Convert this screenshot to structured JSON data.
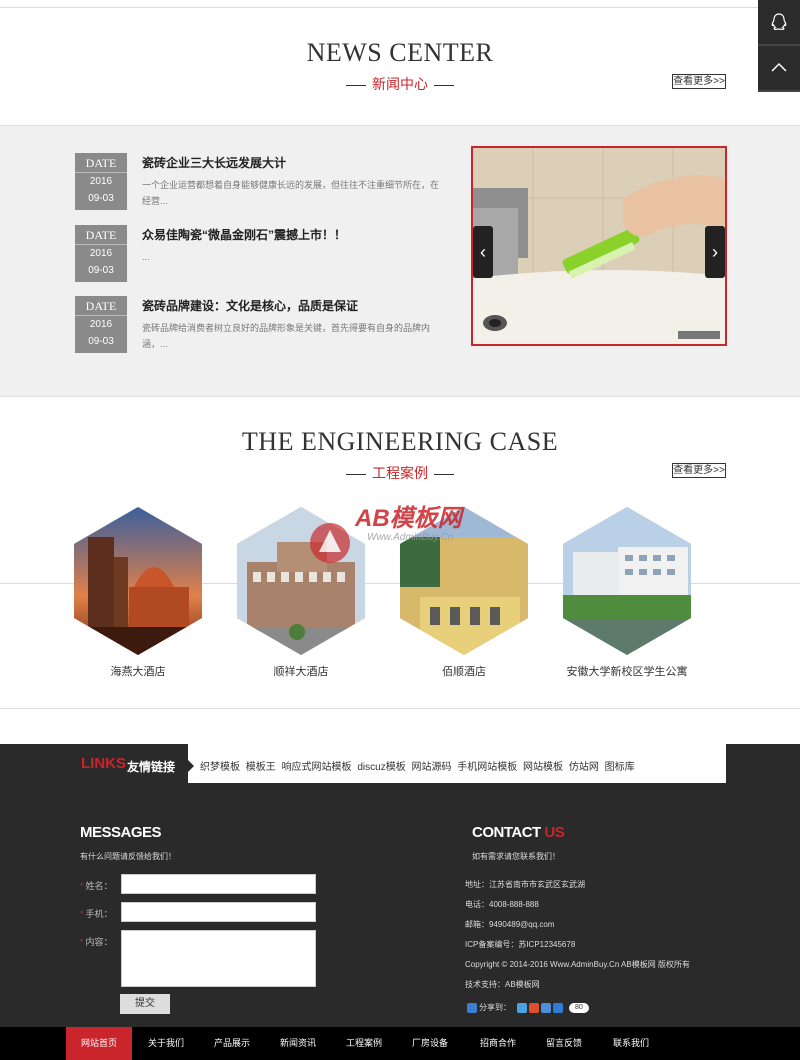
{
  "side_buttons": {
    "qq_icon": "qq-icon",
    "top_icon": "arrow-up-icon"
  },
  "news_section": {
    "title": "NEWS CENTER",
    "subtitle": "新闻中心",
    "more_label": "查看更多>>",
    "items": [
      {
        "date_label": "DATE",
        "year": "2016",
        "month_day": "09-03",
        "title": "瓷砖企业三大长远发展大计",
        "desc": "一个企业运营都想着自身能够健康长远的发展，但往往不注重细节所在，在经营..."
      },
      {
        "date_label": "DATE",
        "year": "2016",
        "month_day": "09-03",
        "title": "众易佳陶瓷“微晶金刚石”震撼上市！！",
        "desc": "..."
      },
      {
        "date_label": "DATE",
        "year": "2016",
        "month_day": "09-03",
        "title": "瓷砖品牌建设：文化是核心，品质是保证",
        "desc": "瓷砖品牌给消费者树立良好的品牌形象是关键，首先得要有自身的品牌内涵，..."
      }
    ],
    "slider": {
      "prev": "‹",
      "next": "›"
    }
  },
  "case_section": {
    "title": "THE ENGINEERING CASE",
    "subtitle": "工程案例",
    "more_label": "查看更多>>",
    "cases": [
      {
        "label": "海燕大酒店"
      },
      {
        "label": "顺祥大酒店"
      },
      {
        "label": "佰顺酒店"
      },
      {
        "label": "安徽大学新校区学生公寓"
      }
    ],
    "watermark": {
      "logo": "AB模板网",
      "url": "Www.AdminBuy.Cn"
    }
  },
  "links": {
    "head_en": "LINKS",
    "head_cn": "友情链接",
    "items": [
      "织梦模板",
      "模板王",
      "响应式网站模板",
      "discuz模板",
      "网站源码",
      "手机网站模板",
      "网站模板",
      "仿站网",
      "图标库"
    ]
  },
  "messages": {
    "title": "MESSAGES",
    "subtitle": "有什么问题请反馈给我们！",
    "name_label": "姓名：",
    "phone_label": "手机：",
    "content_label": "内容：",
    "required_mark": "*",
    "submit_label": "提交"
  },
  "contact": {
    "title_main": "CONTACT",
    "title_accent": "US",
    "subtitle": "如有需求请您联系我们！",
    "lines": [
      "地址：江苏省南市市玄武区玄武湖",
      "电话：4008-888-888",
      "邮箱：9490489@qq.com",
      "ICP备案编号：苏ICP12345678",
      "Copyright © 2014-2016 Www.AdminBuy.Cn AB模板网 版权所有",
      "技术支持：AB模板网"
    ],
    "share_label": "分享到：",
    "share_count": "80"
  },
  "bottom_nav": {
    "items": [
      "网站首页",
      "关于我们",
      "产品展示",
      "新闻资讯",
      "工程案例",
      "厂房设备",
      "招商合作",
      "留言反馈",
      "联系我们"
    ],
    "active_index": 0
  },
  "colors": {
    "accent": "#c9252b",
    "footer_bg": "#2a2a2a",
    "band_bg": "#f0f0f0"
  }
}
